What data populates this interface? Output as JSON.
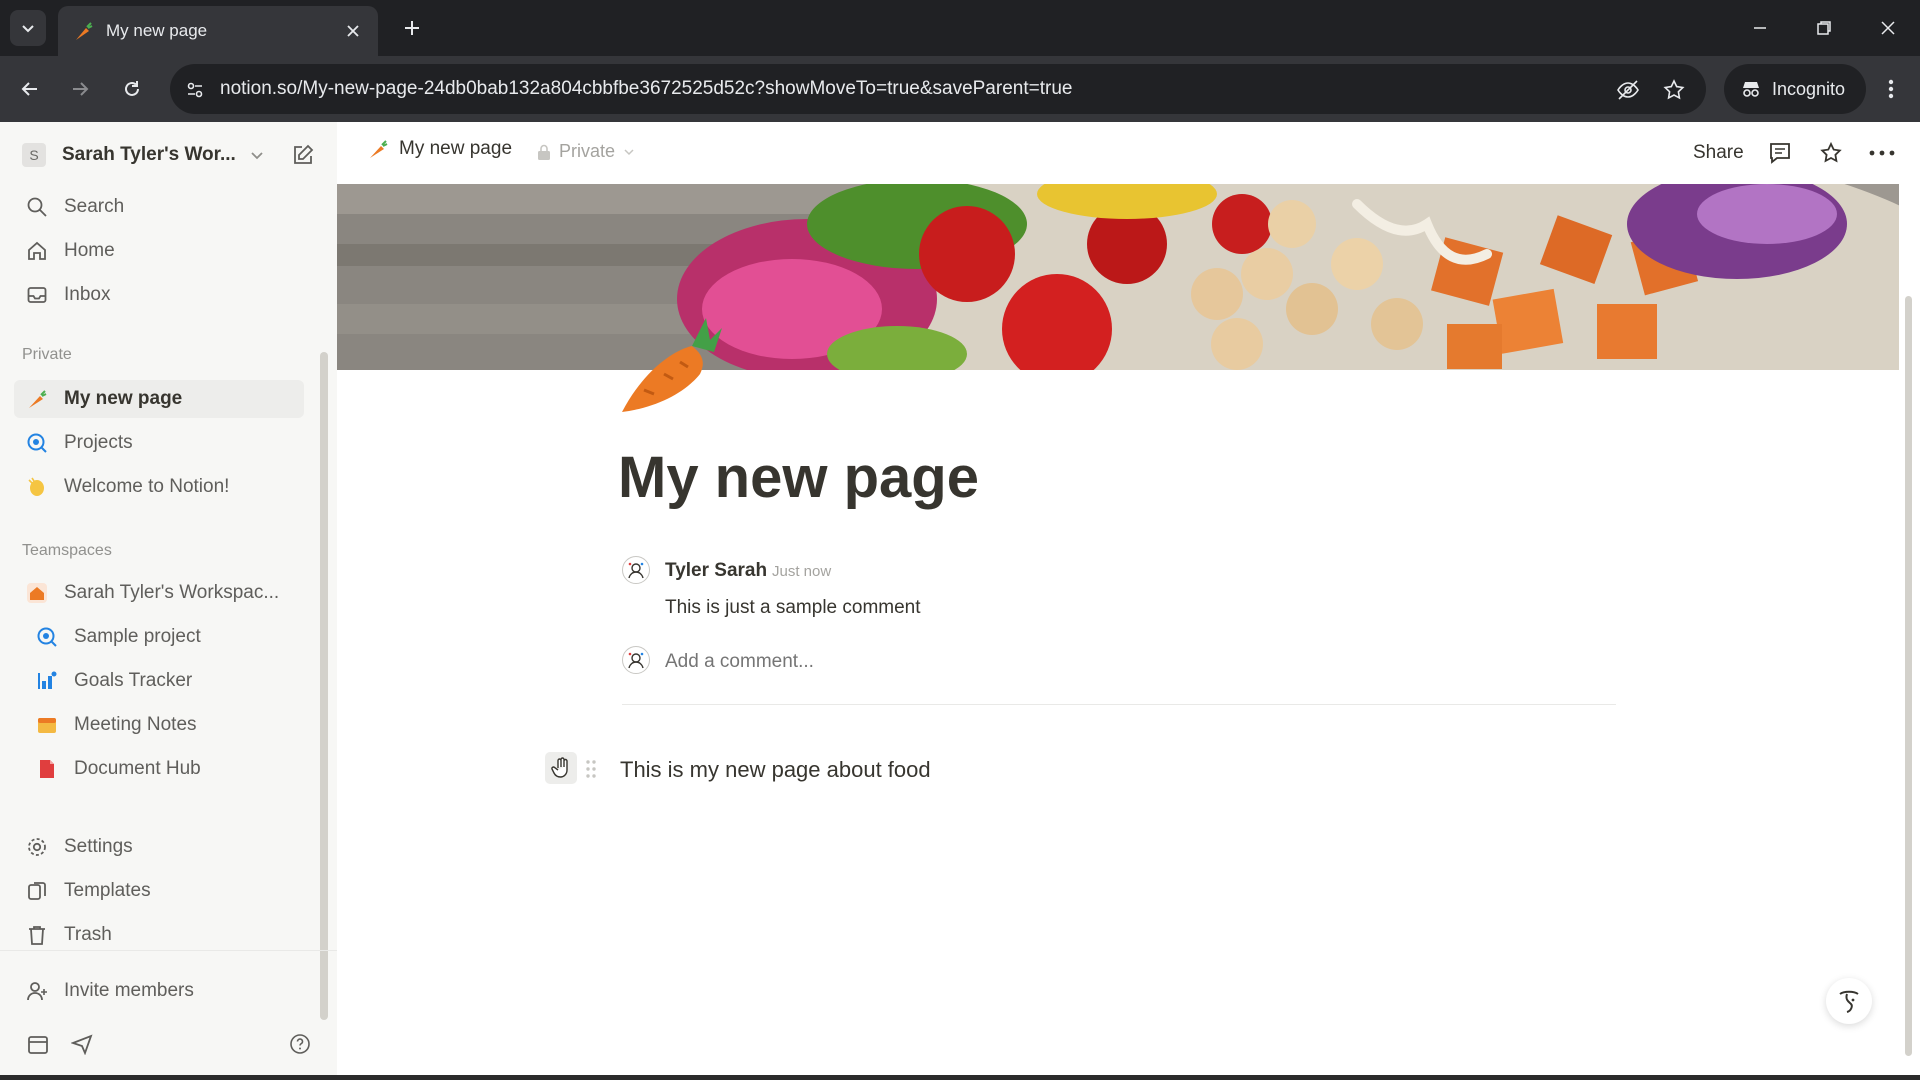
{
  "browser": {
    "tab_title": "My new page",
    "url": "notion.so/My-new-page-24db0bab132a804cbbfbe3672525d52c?showMoveTo=true&saveParent=true",
    "incognito_label": "Incognito"
  },
  "sidebar": {
    "workspace_initial": "S",
    "workspace_name": "Sarah Tyler's Wor...",
    "top_items": [
      {
        "label": "Search",
        "icon": "search-icon"
      },
      {
        "label": "Home",
        "icon": "home-icon"
      },
      {
        "label": "Inbox",
        "icon": "inbox-icon"
      }
    ],
    "private_heading": "Private",
    "private_items": [
      {
        "label": "My new page",
        "icon": "carrot-icon",
        "active": true
      },
      {
        "label": "Projects",
        "icon": "projects-icon"
      },
      {
        "label": "Welcome to Notion!",
        "icon": "wave-hand-icon"
      }
    ],
    "teamspaces_heading": "Teamspaces",
    "teamspace_name": "Sarah Tyler's Workspac...",
    "teamspace_items": [
      {
        "label": "Sample project",
        "icon": "projects-icon"
      },
      {
        "label": "Goals Tracker",
        "icon": "chart-icon"
      },
      {
        "label": "Meeting Notes",
        "icon": "calendar-icon"
      },
      {
        "label": "Document Hub",
        "icon": "document-icon"
      }
    ],
    "bottom_items": [
      {
        "label": "Settings",
        "icon": "gear-icon"
      },
      {
        "label": "Templates",
        "icon": "templates-icon"
      },
      {
        "label": "Trash",
        "icon": "trash-icon"
      }
    ],
    "invite_label": "Invite members"
  },
  "topbar": {
    "breadcrumb_title": "My new page",
    "privacy_label": "Private",
    "share_label": "Share"
  },
  "page": {
    "title": "My new page",
    "comment": {
      "author": "Tyler Sarah",
      "time": "Just now",
      "body": "This is just a sample comment"
    },
    "comment_placeholder": "Add a comment...",
    "block_text": "This is my new page about food"
  },
  "colors": {
    "accent_orange": "#ec7a24",
    "sidebar_bg": "#f7f7f5",
    "text": "#37352f"
  }
}
